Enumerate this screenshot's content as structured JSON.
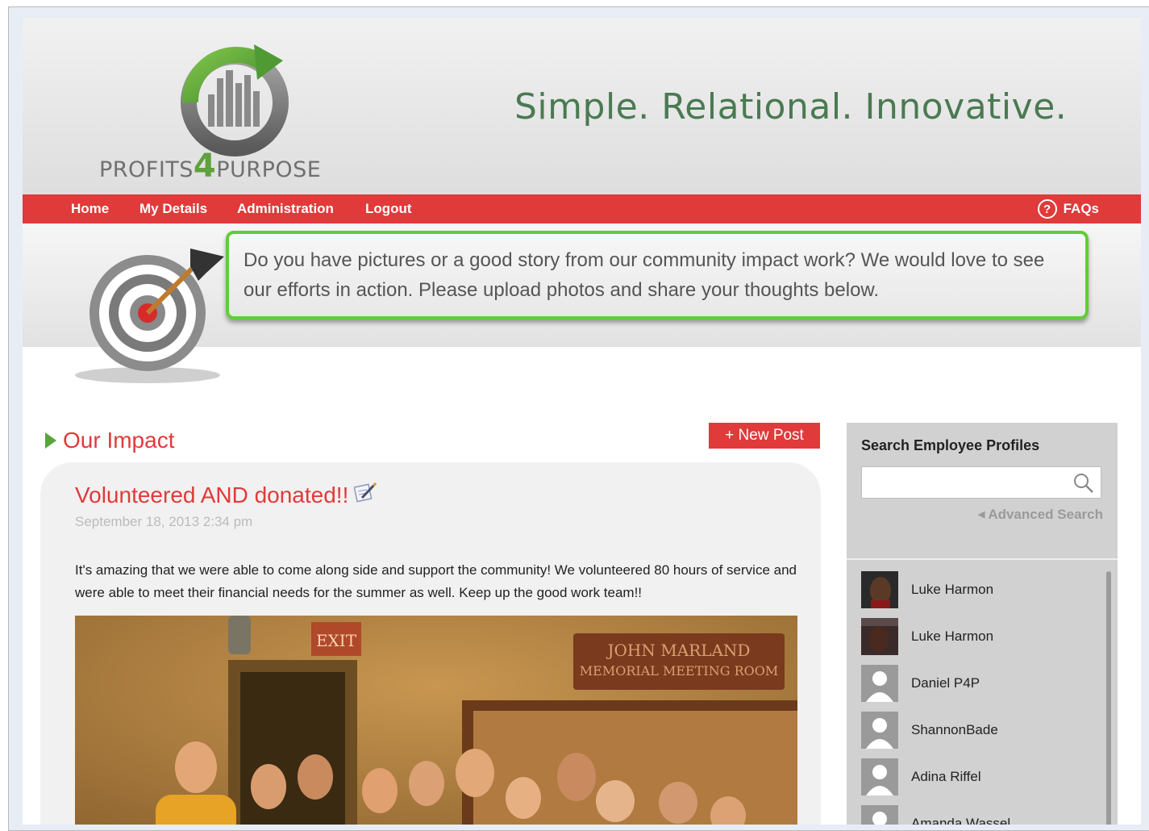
{
  "header": {
    "logo_text_before": "PROFITS",
    "logo_text_four": "4",
    "logo_text_after": "PURPOSE",
    "tagline": "Simple. Relational. Innovative."
  },
  "nav": {
    "items": [
      "Home",
      "My Details",
      "Administration",
      "Logout"
    ],
    "faq_label": "FAQs",
    "faq_icon_glyph": "?"
  },
  "banner": {
    "message": "Do you have pictures or a good story from our community impact work? We would love to see our efforts in action. Please upload photos and share your thoughts below."
  },
  "main": {
    "section_title": "Our Impact",
    "new_post_label": "+ New Post",
    "post": {
      "title": "Volunteered AND donated!!",
      "date": "September 18, 2013 2:34 pm",
      "body": "It's amazing that we were able to come along side and support the community!  We volunteered 80 hours of service and were able to meet their financial needs for the summer as well.  Keep up the good work team!!",
      "photo_sign_exit": "EXIT",
      "photo_plaque_line1": "JOHN MARLAND",
      "photo_plaque_line2": "MEMORIAL MEETING ROOM"
    }
  },
  "sidebar": {
    "title": "Search Employee Profiles",
    "search_value": "",
    "advanced_search_label": "Advanced Search",
    "people": [
      {
        "name": "Luke Harmon",
        "avatar": "photo"
      },
      {
        "name": "Luke Harmon",
        "avatar": "photo"
      },
      {
        "name": "Daniel P4P",
        "avatar": "default"
      },
      {
        "name": "ShannonBade",
        "avatar": "default"
      },
      {
        "name": "Adina Riffel",
        "avatar": "default"
      },
      {
        "name": "Amanda Wassel",
        "avatar": "default"
      }
    ]
  },
  "colors": {
    "brand_red": "#e03a3a",
    "brand_green": "#58a43a",
    "highlight_green": "#62cc3a",
    "tagline_green": "#4a7a52"
  }
}
